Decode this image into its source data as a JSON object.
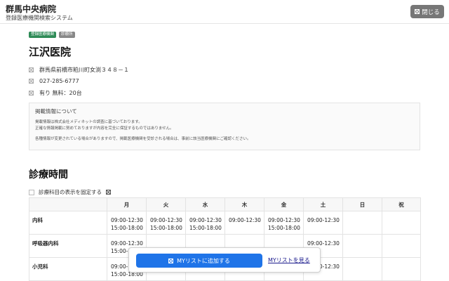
{
  "header": {
    "title": "群馬中央病院",
    "subtitle": "登録医療機関検索システム",
    "close_label": "閉じる"
  },
  "badges": [
    "登録医療機関",
    "診療所"
  ],
  "clinic": {
    "name": "江沢医院",
    "address": "群馬県前橋市粕川町女渕３４８－１",
    "phone": "027-285-6777",
    "parking": "有り  無料：20台"
  },
  "notice": {
    "title": "掲載情報について",
    "line1": "掲載情報は株式会社メディネットの調査に基づいております。",
    "line2": "正確な情報掲載に努めておりますが内容を完全に保証するものではありません。",
    "line3": "各種情報が変更されている場合がありますので、掲載医療機関を受診される場合は、事前に該当医療機関にご確認ください。"
  },
  "schedule": {
    "title": "診療時間",
    "fix_label": "診療科目の表示を固定する",
    "days": [
      "月",
      "火",
      "水",
      "木",
      "金",
      "土",
      "日",
      "祝"
    ],
    "rows": [
      {
        "dept": "内科",
        "cells": [
          "09:00-12:30 15:00-18:00",
          "09:00-12:30 15:00-18:00",
          "09:00-12:30 15:00-18:00",
          "09:00-12:30",
          "09:00-12:30 15:00-18:00",
          "09:00-12:30",
          "",
          ""
        ]
      },
      {
        "dept": "呼吸器内科",
        "cells": [
          "09:00-12:30 15:00-18:00",
          "",
          "",
          "",
          "",
          "09:00-12:30",
          "",
          ""
        ]
      },
      {
        "dept": "小児科",
        "cells": [
          "09:00-12:30 15:00-18:00",
          "",
          "",
          "",
          "",
          "09:00-12:30",
          "",
          ""
        ]
      }
    ]
  },
  "actions": {
    "add_label": "MYリストに追加する",
    "view_label": "MYリストを見る"
  }
}
